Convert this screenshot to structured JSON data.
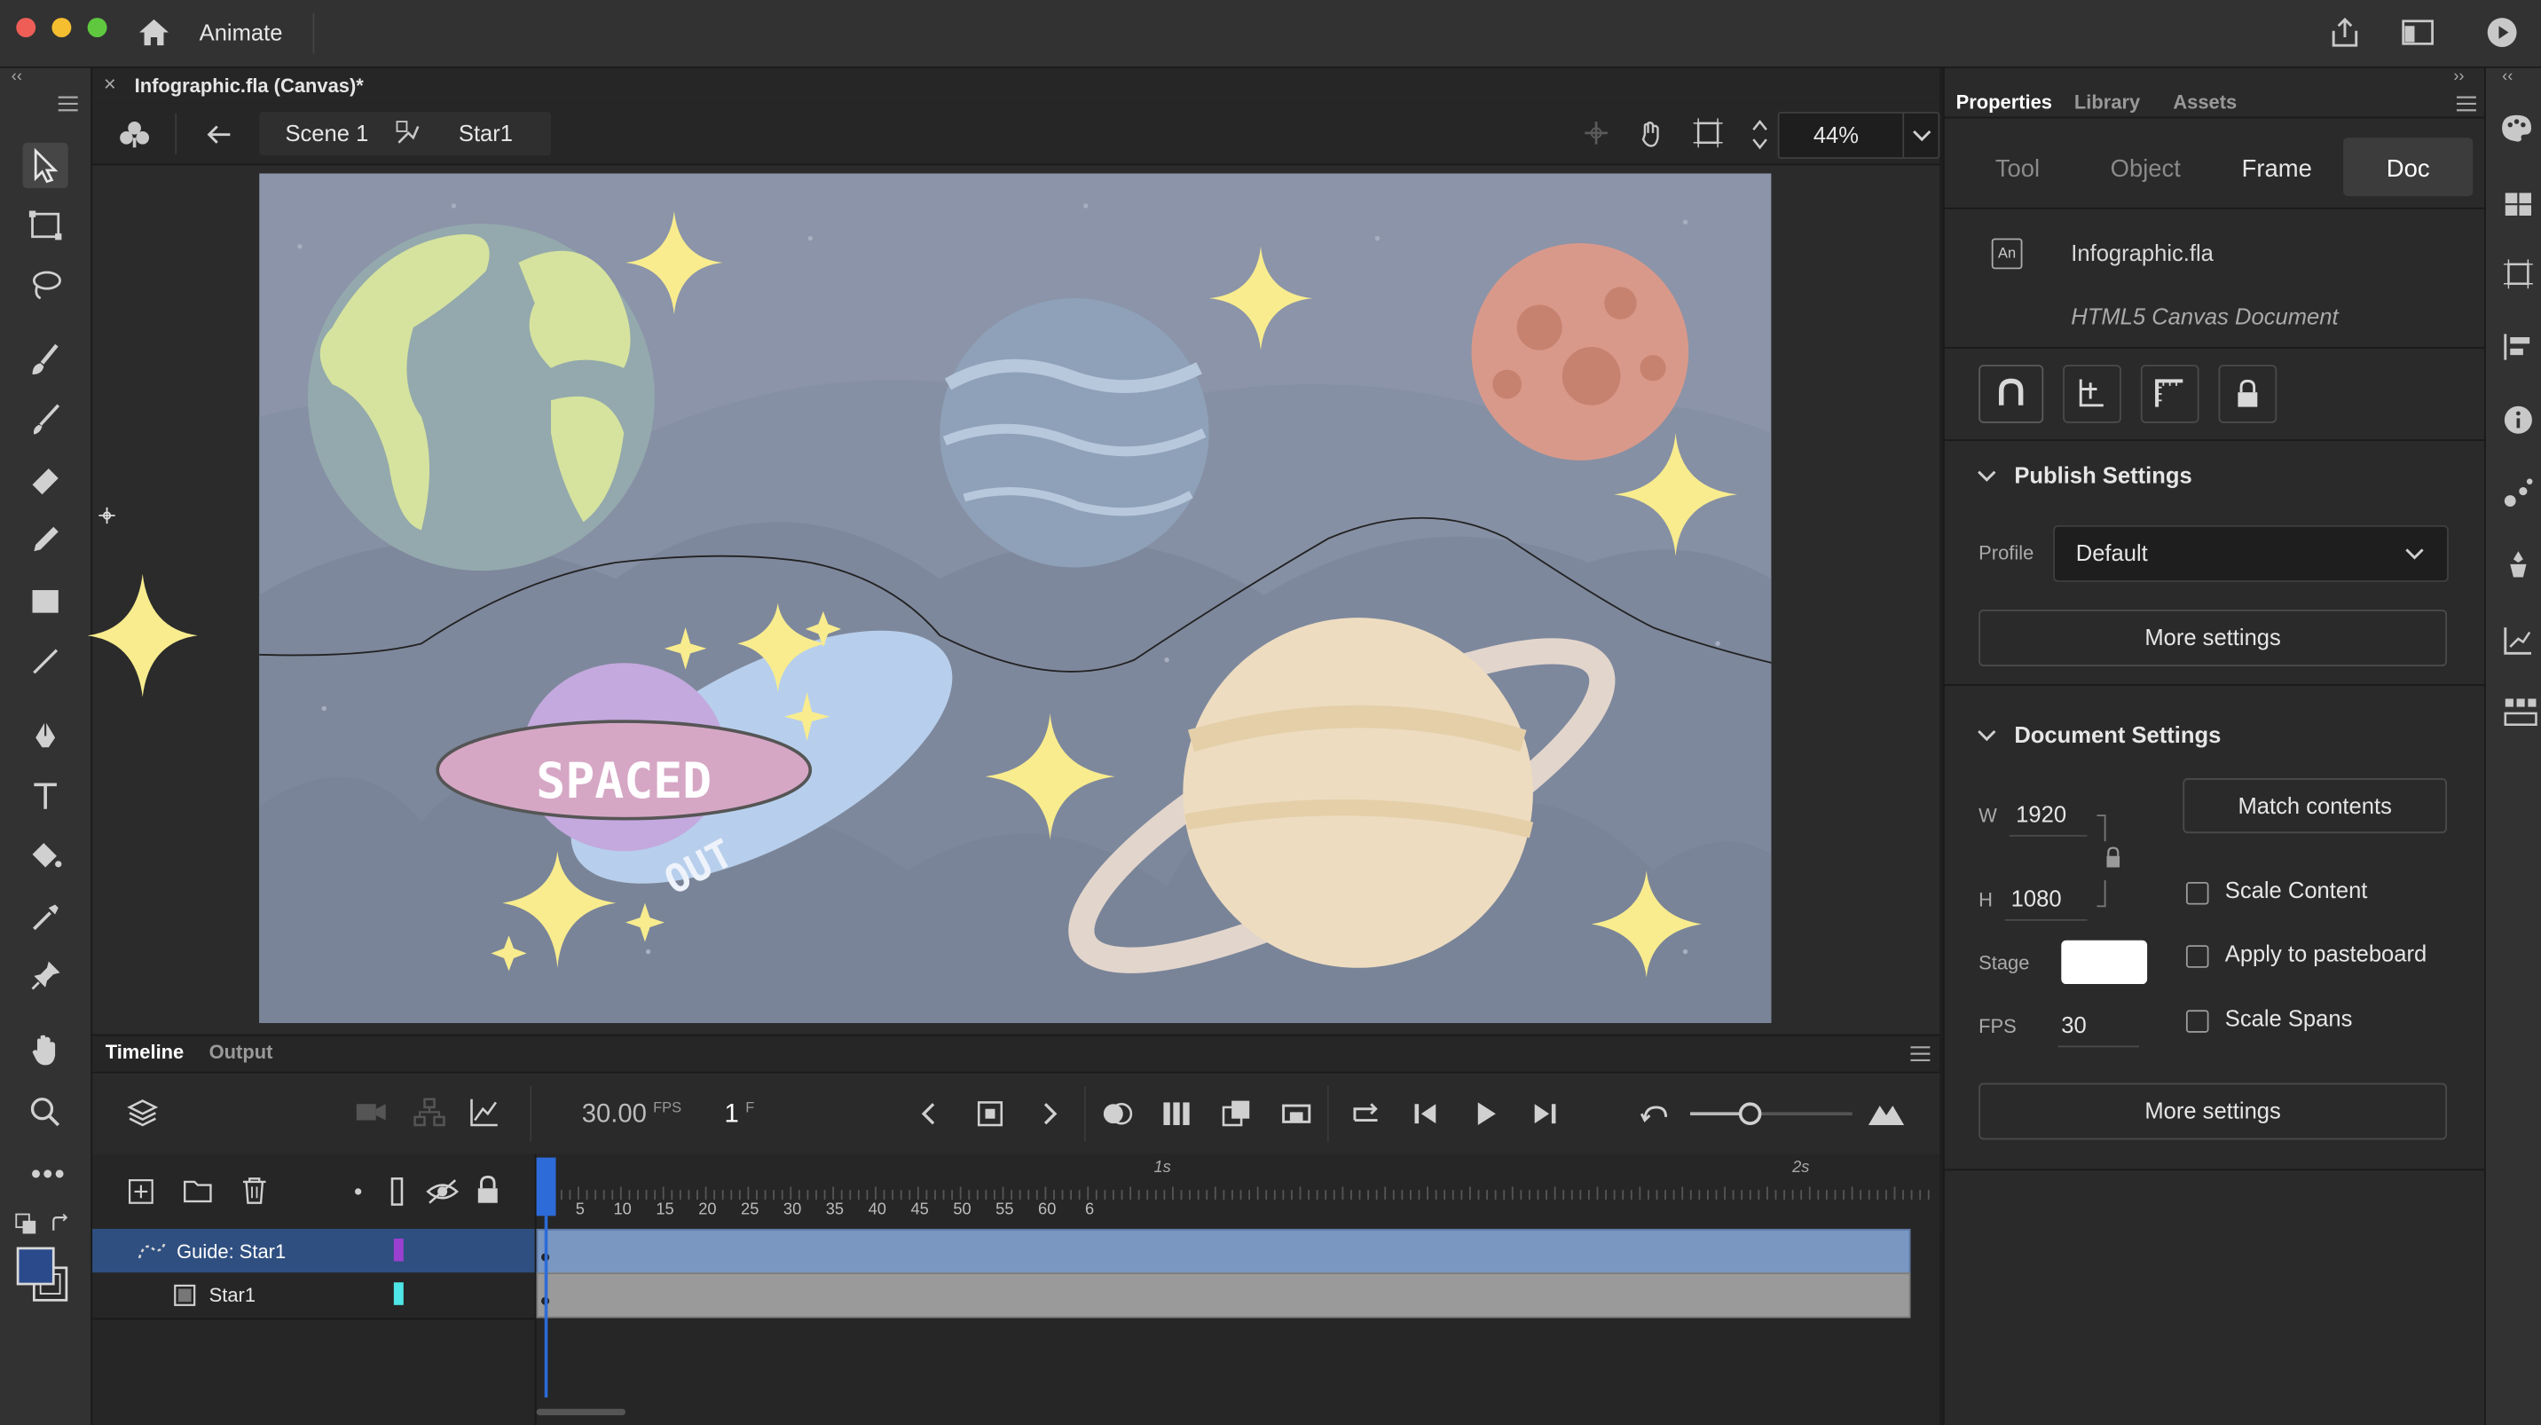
{
  "app": {
    "name": "Animate"
  },
  "document_tab": {
    "title": "Infographic.fla (Canvas)*"
  },
  "edit_bar": {
    "scene": "Scene 1",
    "symbol": "Star1",
    "zoom": "44%"
  },
  "properties_panel": {
    "tabs": [
      "Properties",
      "Library",
      "Assets"
    ],
    "subtabs": [
      "Tool",
      "Object",
      "Frame",
      "Doc"
    ],
    "doc_name": "Infographic.fla",
    "doc_type": "HTML5 Canvas Document",
    "doc_badge": "An",
    "publish_settings": {
      "title": "Publish Settings",
      "profile_label": "Profile",
      "profile_value": "Default",
      "more_settings": "More settings"
    },
    "document_settings": {
      "title": "Document Settings",
      "w_label": "W",
      "w_value": "1920",
      "h_label": "H",
      "h_value": "1080",
      "match_contents": "Match contents",
      "stage_label": "Stage",
      "stage_color": "#ffffff",
      "fps_label": "FPS",
      "fps_value": "30",
      "scale_content": "Scale Content",
      "apply_pasteboard": "Apply to pasteboard",
      "scale_spans": "Scale Spans",
      "more_settings": "More settings"
    }
  },
  "timeline": {
    "tabs": [
      "Timeline",
      "Output"
    ],
    "fps": "30.00",
    "fps_unit": "FPS",
    "frame": "1",
    "frame_unit": "F",
    "ruler_seconds": [
      "1s",
      "2s"
    ],
    "ruler_frames": [
      "5",
      "10",
      "15",
      "20",
      "25",
      "30",
      "35",
      "40",
      "45",
      "50",
      "55",
      "60",
      "6"
    ],
    "layers": [
      {
        "name": "Guide: Star1",
        "color": "#9b3fd1",
        "selected": true
      },
      {
        "name": "Star1",
        "color": "#4ee6e6",
        "selected": false
      }
    ]
  },
  "artwork": {
    "banner": "SPACED",
    "subtitle": "OUT"
  },
  "colors": {
    "accent": "#2d6bd8",
    "selection": "#2f4f80",
    "stage_bg": "#8b94a8",
    "fill_swatch": "#2a4a8c"
  }
}
